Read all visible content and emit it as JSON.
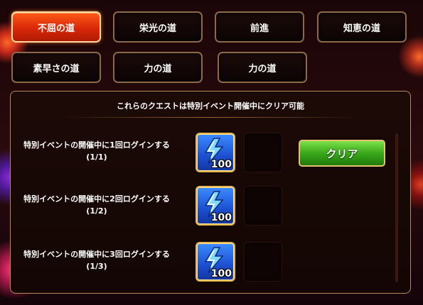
{
  "tabs": [
    {
      "label": "不屈の道",
      "active": true
    },
    {
      "label": "栄光の道",
      "active": false
    },
    {
      "label": "前進",
      "active": false
    },
    {
      "label": "知恵の道",
      "active": false
    },
    {
      "label": "素早さの道",
      "active": false
    },
    {
      "label": "力の道",
      "active": false
    },
    {
      "label": "力の道",
      "active": false
    }
  ],
  "panel": {
    "title": "これらのクエストは特別イベント開催中にクリア可能"
  },
  "quests": [
    {
      "description": "特別イベントの開催中に1回ログインする",
      "progress": "(1/1)",
      "reward_icon": "energy-bolt-icon",
      "reward_count": "100"
    },
    {
      "description": "特別イベントの開催中に2回ログインする",
      "progress": "(1/2)",
      "reward_icon": "energy-bolt-icon",
      "reward_count": "100"
    },
    {
      "description": "特別イベントの開催中に3回ログインする",
      "progress": "(1/3)",
      "reward_icon": "energy-bolt-icon",
      "reward_count": "100"
    }
  ],
  "clear_button": {
    "label": "クリア"
  },
  "colors": {
    "active_tab": "#e0300c",
    "clear_button": "#3aa81a",
    "reward_bg": "#2a66e8",
    "border_gold": "#e9b84a"
  }
}
